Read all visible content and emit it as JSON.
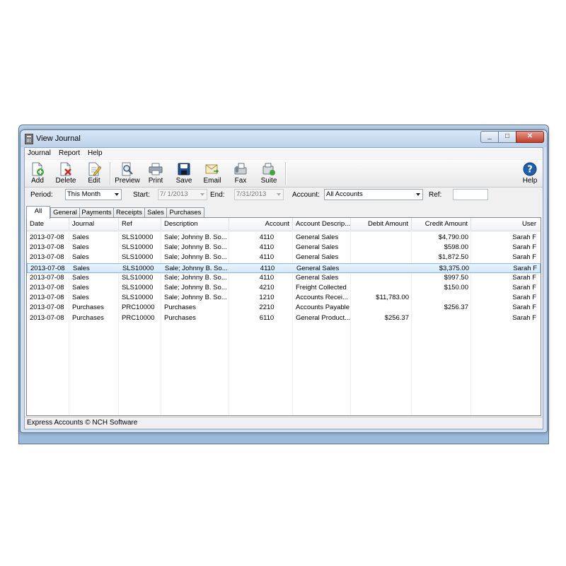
{
  "window": {
    "title": "View Journal"
  },
  "status_text": "Express Accounts © NCH Software",
  "menu": [
    "Journal",
    "Report",
    "Help"
  ],
  "toolbar": [
    {
      "label": "Add",
      "icon": "add-document-icon"
    },
    {
      "label": "Delete",
      "icon": "delete-document-icon"
    },
    {
      "label": "Edit",
      "icon": "edit-document-icon"
    },
    {
      "label": "Preview",
      "icon": "preview-icon"
    },
    {
      "label": "Print",
      "icon": "printer-icon"
    },
    {
      "label": "Save",
      "icon": "floppy-disk-icon"
    },
    {
      "label": "Email",
      "icon": "email-icon"
    },
    {
      "label": "Fax",
      "icon": "fax-icon"
    },
    {
      "label": "Suite",
      "icon": "suite-icon"
    }
  ],
  "help": {
    "label": "Help",
    "icon": "help-icon"
  },
  "filters": {
    "period_label": "Period:",
    "period_value": "This Month",
    "start_label": "Start:",
    "start_value": "7/ 1/2013",
    "end_label": "End:",
    "end_value": "7/31/2013",
    "account_label": "Account:",
    "account_value": "All Accounts",
    "ref_label": "Ref:",
    "ref_value": ""
  },
  "tabs": [
    "All",
    "General",
    "Payments",
    "Receipts",
    "Sales",
    "Purchases"
  ],
  "active_tab": "All",
  "columns": [
    "Date",
    "Journal",
    "Ref",
    "Description",
    "Account",
    "Account Descrip...",
    "Debit Amount",
    "Credit Amount",
    "User"
  ],
  "rows": [
    [
      "2013-07-08",
      "Sales",
      "SLS10000",
      "Sale; Johnny B. So...",
      "4110",
      "General Sales",
      "",
      "$4,790.00",
      "Sarah F"
    ],
    [
      "2013-07-08",
      "Sales",
      "SLS10000",
      "Sale; Johnny B. So...",
      "4110",
      "General Sales",
      "",
      "$598.00",
      "Sarah F"
    ],
    [
      "2013-07-08",
      "Sales",
      "SLS10000",
      "Sale; Johnny B. So...",
      "4110",
      "General Sales",
      "",
      "$1,872.50",
      "Sarah F"
    ],
    [
      "2013-07-08",
      "Sales",
      "SLS10000",
      "Sale; Johnny B. So...",
      "4110",
      "General Sales",
      "",
      "$3,375.00",
      "Sarah F"
    ],
    [
      "2013-07-08",
      "Sales",
      "SLS10000",
      "Sale; Johnny B. So...",
      "4110",
      "General Sales",
      "",
      "$997.50",
      "Sarah F"
    ],
    [
      "2013-07-08",
      "Sales",
      "SLS10000",
      "Sale; Johnny B. So...",
      "4210",
      "Freight Collected",
      "",
      "$150.00",
      "Sarah F"
    ],
    [
      "2013-07-08",
      "Sales",
      "SLS10000",
      "Sale; Johnny B. So...",
      "1210",
      "Accounts Recei...",
      "$11,783.00",
      "",
      "Sarah F"
    ],
    [
      "2013-07-08",
      "Purchases",
      "PRC10000",
      "Purchases",
      "2210",
      "Accounts Payable",
      "",
      "$256.37",
      "Sarah F"
    ],
    [
      "2013-07-08",
      "Purchases",
      "PRC10000",
      "Purchases",
      "6110",
      "General Product...",
      "$256.37",
      "",
      "Sarah F"
    ]
  ],
  "selected_row": 3,
  "colors": {
    "selection": "#d3e7fb",
    "selection_border": "#84b8ec",
    "close_button": "#c23d26"
  }
}
